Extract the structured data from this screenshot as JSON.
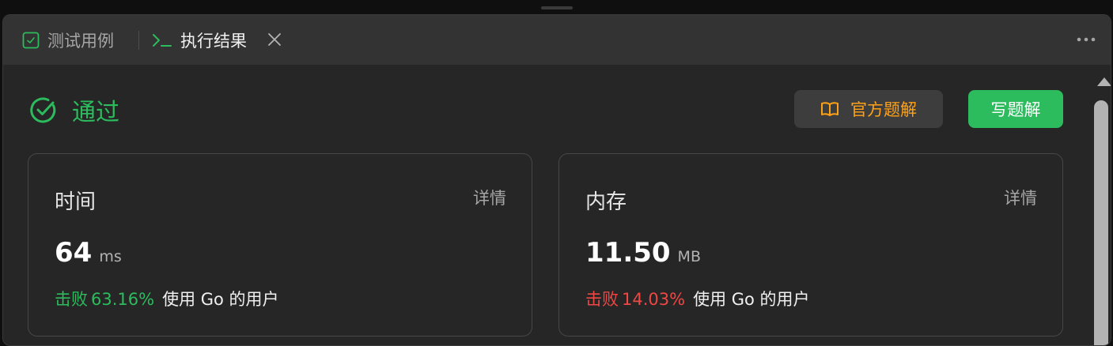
{
  "tabs": [
    {
      "label": "测试用例",
      "icon": "checkbox-icon",
      "active": false
    },
    {
      "label": "执行结果",
      "icon": "terminal-icon",
      "active": true
    }
  ],
  "status": {
    "label": "通过",
    "icon": "check-circle-icon",
    "color": "#2cbb5d"
  },
  "actions": {
    "official_solution": "官方题解",
    "write_solution": "写题解"
  },
  "cards": {
    "time": {
      "title": "时间",
      "detail": "详情",
      "value": "64",
      "unit": "ms",
      "beat_prefix": "击败",
      "beat_percent": "63.16%",
      "beat_suffix": "使用 Go 的用户",
      "beat_color": "#2cbb5d"
    },
    "memory": {
      "title": "内存",
      "detail": "详情",
      "value": "11.50",
      "unit": "MB",
      "beat_prefix": "击败",
      "beat_percent": "14.03%",
      "beat_suffix": "使用 Go 的用户",
      "beat_color": "#ef4743"
    }
  },
  "colors": {
    "accent": "#2cbb5d",
    "warning": "#ffa116",
    "danger": "#ef4743",
    "background": "#262626"
  }
}
